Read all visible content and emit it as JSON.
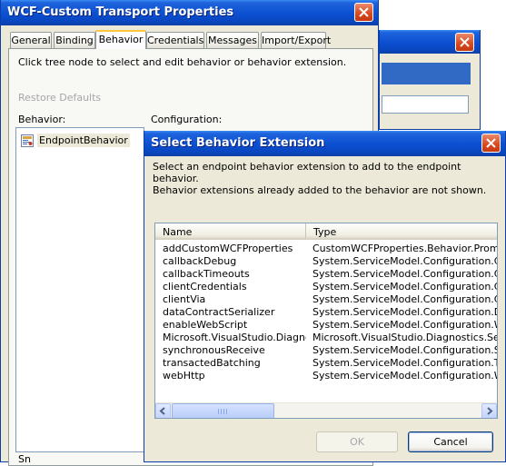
{
  "back_window": {
    "title": "WCF-Custom Transport Properties",
    "tabs": [
      {
        "label": "General",
        "active": false
      },
      {
        "label": "Binding",
        "active": false
      },
      {
        "label": "Behavior",
        "active": true
      },
      {
        "label": "Credentials",
        "active": false
      },
      {
        "label": "Messages",
        "active": false
      },
      {
        "label": "Import/Export",
        "active": false
      }
    ],
    "instruction": "Click tree node to select and edit behavior or behavior extension.",
    "restore_defaults": "Restore Defaults",
    "behavior_label": "Behavior:",
    "configuration_label": "Configuration:",
    "tree_node": "EndpointBehavior",
    "bottom_fragment": "Sn"
  },
  "front_dialog": {
    "title": "Select Behavior Extension",
    "description_line1": "Select an endpoint behavior extension to add to the endpoint behavior.",
    "description_line2": "Behavior extensions already added to the behavior are not shown.",
    "columns": {
      "name": "Name",
      "type": "Type"
    },
    "rows": [
      {
        "name": "addCustomWCFProperties",
        "type": "CustomWCFProperties.Behavior.PromoteU"
      },
      {
        "name": "callbackDebug",
        "type": "System.ServiceModel.Configuration.Callba"
      },
      {
        "name": "callbackTimeouts",
        "type": "System.ServiceModel.Configuration.Callba"
      },
      {
        "name": "clientCredentials",
        "type": "System.ServiceModel.Configuration.ClientC"
      },
      {
        "name": "clientVia",
        "type": "System.ServiceModel.Configuration.ClientV"
      },
      {
        "name": "dataContractSerializer",
        "type": "System.ServiceModel.Configuration.DataC"
      },
      {
        "name": "enableWebScript",
        "type": "System.ServiceModel.Configuration.WebS"
      },
      {
        "name": "Microsoft.VisualStudio.Diagnos...",
        "type": "Microsoft.VisualStudio.Diagnostics.Service"
      },
      {
        "name": "synchronousReceive",
        "type": "System.ServiceModel.Configuration.Synch"
      },
      {
        "name": "transactedBatching",
        "type": "System.ServiceModel.Configuration.Transa"
      },
      {
        "name": "webHttp",
        "type": "System.ServiceModel.Configuration.WebH"
      }
    ],
    "ok_label": "OK",
    "cancel_label": "Cancel"
  },
  "colors": {
    "title_bar": "#0b4fd1",
    "close_button": "#d9481d",
    "dialog_face": "#ece9d8",
    "selection": "#316ac5"
  },
  "icons": {
    "close": "close-icon",
    "tree_node": "behavior-node-icon",
    "scroll_left": "arrow-left-icon",
    "scroll_right": "arrow-right-icon"
  }
}
